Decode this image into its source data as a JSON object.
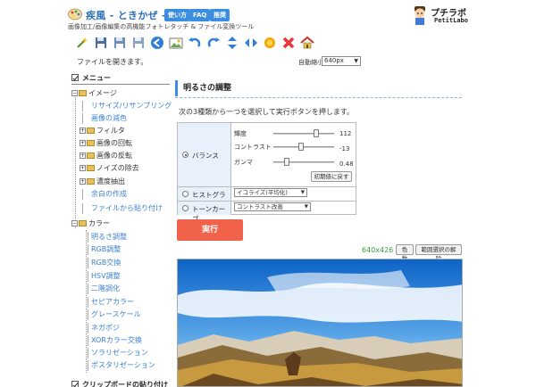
{
  "header": {
    "title": "疾風 - ときかぜ -",
    "subtitle": "画像加工/画像編集の高機能フォトレタッチ & ファイル変換ツール",
    "nav": [
      "使い方",
      "FAQ",
      "推奨"
    ],
    "brand_name": "プチラボ",
    "brand_sub": "PetitLabo"
  },
  "toolbar": {
    "icons": [
      "wand-icon",
      "save-icon",
      "save-as-icon",
      "save-alt-icon",
      "back-icon",
      "image-icon",
      "rotate-left-icon",
      "rotate-right-icon",
      "flip-vertical-icon",
      "flip-horizontal-icon",
      "settings-icon",
      "delete-icon",
      "home-icon"
    ]
  },
  "status": {
    "message": "ファイルを開きます。",
    "zoom_label": "自動縮小",
    "zoom_value": "640px"
  },
  "sidebar": {
    "menu_title": "メニュー",
    "image_group": "イメージ",
    "image_items": [
      "リサイズ/リサンプリング",
      "画像の減色"
    ],
    "filter": "フィルタ",
    "rotate": "画像の回転",
    "reverse": "画像の反転",
    "noise": "ノイズの除去",
    "extract": "濃度抽出",
    "margin": "余白の作成",
    "paste_file": "ファイルから貼り付け",
    "color_group": "カラー",
    "color_items": [
      "明るさ調整",
      "RGB調整",
      "RGB交換",
      "HSV調整",
      "二階調化",
      "セピアカラー",
      "グレースケール",
      "ネガポジ",
      "XORカラー交換",
      "ソラリゼーション",
      "ポスタリゼーション"
    ],
    "clipboard": "クリップボードの貼り付け"
  },
  "panel": {
    "title": "明るさの調整",
    "instruction": "次の3種類から一つを選択して実行ボタンを押します。",
    "options": {
      "balance": "バランス",
      "histogram": "ヒストグラム",
      "tonecurve": "トーンカーブ"
    },
    "sliders": [
      {
        "label": "輝度",
        "value": "112",
        "level": 0.72
      },
      {
        "label": "コントラスト",
        "value": "-13",
        "level": 0.45
      },
      {
        "label": "ガンマ",
        "value": "0.48",
        "level": 0.2
      }
    ],
    "reset_label": "初期値に戻す",
    "histogram_select": "イコライズ(平均化)",
    "tonecurve_select": "コントラスト改善",
    "run_label": "実行",
    "image_size": "640x426",
    "color_button": "色数",
    "clear_selection": "範囲選択の解除"
  },
  "colors": {
    "accent": "#3a8de0",
    "run": "#f0634a",
    "link": "#3a7fd0",
    "size": "#3a9a3a"
  }
}
